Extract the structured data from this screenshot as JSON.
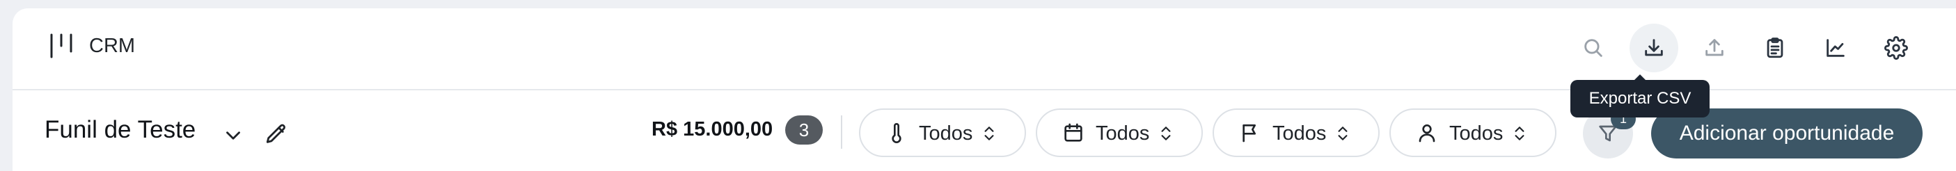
{
  "app": {
    "title": "CRM"
  },
  "toolbar": {
    "buttons": [
      {
        "name": "search",
        "icon": "search-icon"
      },
      {
        "name": "export-csv",
        "icon": "download-icon",
        "active": true
      },
      {
        "name": "import",
        "icon": "upload-icon"
      },
      {
        "name": "clipboard",
        "icon": "clipboard-icon"
      },
      {
        "name": "analytics",
        "icon": "chart-icon"
      },
      {
        "name": "settings",
        "icon": "gear-icon"
      }
    ],
    "tooltip": "Exportar CSV"
  },
  "funnel": {
    "title": "Funil de Teste"
  },
  "summary": {
    "amount": "R$ 15.000,00",
    "count": "3"
  },
  "filters": [
    {
      "icon": "thermometer-icon",
      "label": "Todos"
    },
    {
      "icon": "calendar-icon",
      "label": "Todos"
    },
    {
      "icon": "flag-icon",
      "label": "Todos"
    },
    {
      "icon": "user-icon",
      "label": "Todos"
    }
  ],
  "filter_button": {
    "badge": "1"
  },
  "actions": {
    "add_label": "Adicionar oportunidade"
  },
  "colors": {
    "primary": "#3c5666",
    "badge": "#555a60",
    "tooltip_bg": "#1c2430"
  }
}
